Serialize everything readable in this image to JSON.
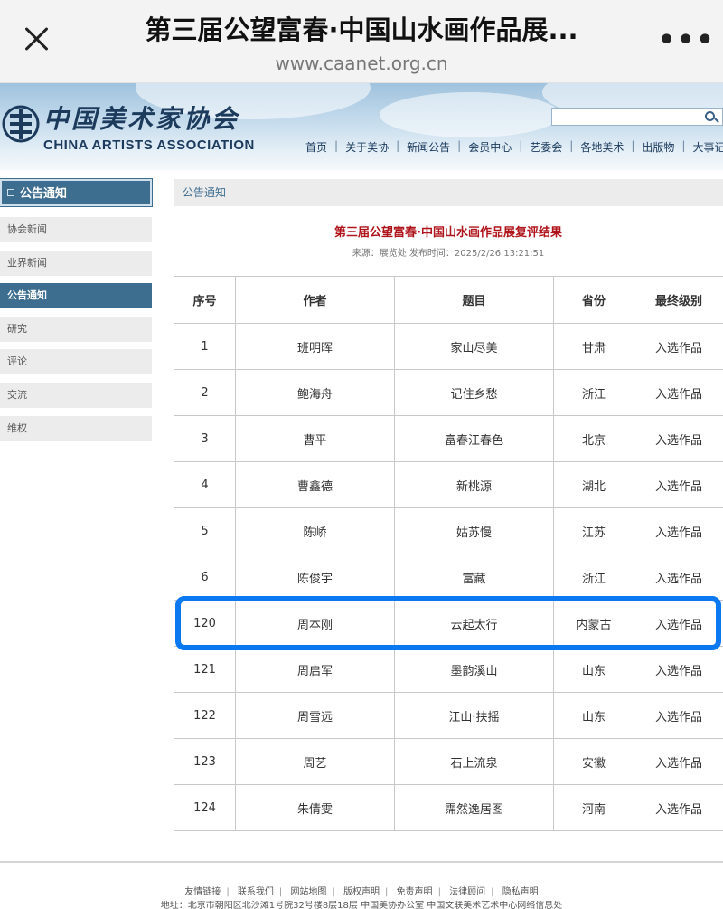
{
  "browser": {
    "title": "第三届公望富春·中国山水画作品展...",
    "url": "www.caanet.org.cn"
  },
  "site": {
    "logo_cn": "中国美术家协会",
    "logo_en": "CHINA ARTISTS ASSOCIATION",
    "nav": [
      "首页",
      "关于美协",
      "新闻公告",
      "会员中心",
      "艺委会",
      "各地美术",
      "出版物",
      "大事记"
    ]
  },
  "sidebar": {
    "heading": "公告通知",
    "items": [
      {
        "label": "协会新闻"
      },
      {
        "label": "业界新闻"
      },
      {
        "label": "公告通知"
      },
      {
        "label": "研究"
      },
      {
        "label": "评论"
      },
      {
        "label": "交流"
      },
      {
        "label": "维权"
      }
    ],
    "active_item": "公告通知"
  },
  "main": {
    "section_title": "公告通知",
    "article_title": "第三届公望富春·中国山水画作品展复评结果",
    "meta": "来源：展览处 发布时间：2025/2/26 13:21:51"
  },
  "table": {
    "headers": [
      "序号",
      "作者",
      "题目",
      "省份",
      "最终级别"
    ],
    "rows": [
      [
        "1",
        "班明晖",
        "家山尽美",
        "甘肃",
        "入选作品"
      ],
      [
        "2",
        "鲍海舟",
        "记住乡愁",
        "浙江",
        "入选作品"
      ],
      [
        "3",
        "曹平",
        "富春江春色",
        "北京",
        "入选作品"
      ],
      [
        "4",
        "曹鑫德",
        "新桃源",
        "湖北",
        "入选作品"
      ],
      [
        "5",
        "陈峤",
        "姑苏慢",
        "江苏",
        "入选作品"
      ],
      [
        "6",
        "陈俊宇",
        "富藏",
        "浙江",
        "入选作品"
      ],
      [
        "120",
        "周本刚",
        "云起太行",
        "内蒙古",
        "入选作品"
      ],
      [
        "121",
        "周启军",
        "墨韵溪山",
        "山东",
        "入选作品"
      ],
      [
        "122",
        "周雪远",
        "江山·扶摇",
        "山东",
        "入选作品"
      ],
      [
        "123",
        "周艺",
        "石上流泉",
        "安徽",
        "入选作品"
      ],
      [
        "124",
        "朱倩雯",
        "霈然逸居图",
        "河南",
        "入选作品"
      ]
    ],
    "highlight_color": "#0a78f0"
  },
  "footer": {
    "links": [
      "友情链接",
      "联系我们",
      "网站地图",
      "版权声明",
      "免责声明",
      "法律顾问",
      "隐私声明"
    ],
    "address": "地址：北京市朝阳区北沙滩1号院32号楼8层18层 中国美协办公室 中国文联美术艺术中心网络信息处"
  },
  "colors": {
    "sidebar_active": "#3d6d8f",
    "title_red": "#b0141b"
  }
}
